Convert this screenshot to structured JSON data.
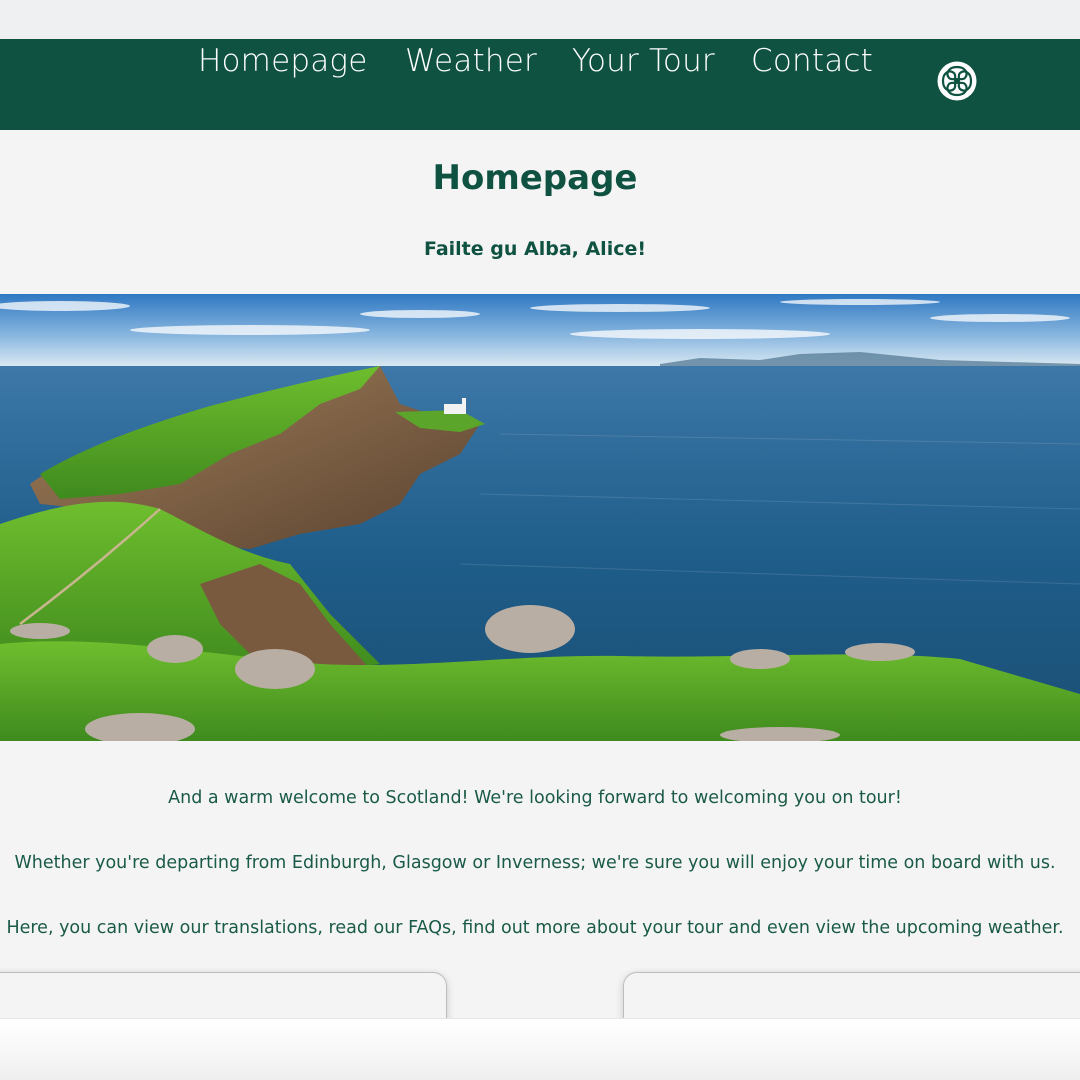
{
  "nav": {
    "items": [
      {
        "label": "Homepage"
      },
      {
        "label": "Weather"
      },
      {
        "label": "Your Tour"
      },
      {
        "label": "Contact"
      }
    ],
    "logo_icon": "celtic-knot-icon"
  },
  "main": {
    "title": "Homepage",
    "greeting": "Failte gu Alba, Alice!",
    "hero_image": "scottish-coastline-lighthouse-image",
    "paragraphs": [
      "And a warm welcome to Scotland! We're looking forward to welcoming you on tour!",
      "Whether you're departing from Edinburgh, Glasgow or Inverness; we're sure you will enjoy your time on board with us.",
      "Here, you can view our translations, read our FAQs, find out more about your tour and even view the upcoming weather."
    ]
  },
  "colors": {
    "brand_green": "#0f5241",
    "text_green": "#1a5a48",
    "page_background": "#f4f4f4",
    "nav_text": "#ffffff"
  }
}
